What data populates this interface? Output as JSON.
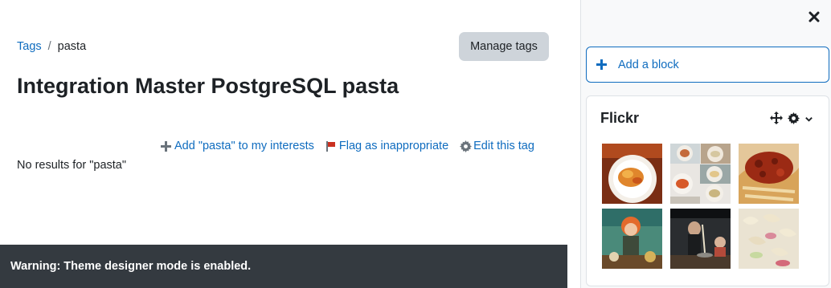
{
  "breadcrumb": {
    "root": "Tags",
    "separator": "/",
    "current": "pasta"
  },
  "manage_tags": "Manage tags",
  "page_title": "Integration Master PostgreSQL pasta",
  "tag_actions": {
    "add_interest": "Add \"pasta\" to my interests",
    "flag": "Flag as inappropriate",
    "edit": "Edit this tag"
  },
  "no_results": "No results for \"pasta\"",
  "warning": "Warning: Theme designer mode is enabled.",
  "drawer": {
    "add_block": "Add a block",
    "flickr": {
      "title": "Flickr",
      "photos": [
        "pasta-plate",
        "pasta-collage",
        "bolognese",
        "illustration",
        "cooking-scene",
        "bowtie-salad"
      ]
    }
  },
  "colors": {
    "link": "#0f6cbf",
    "warning_bg": "#343a40",
    "button_bg": "#ced4da",
    "flag": "#ca3120"
  }
}
